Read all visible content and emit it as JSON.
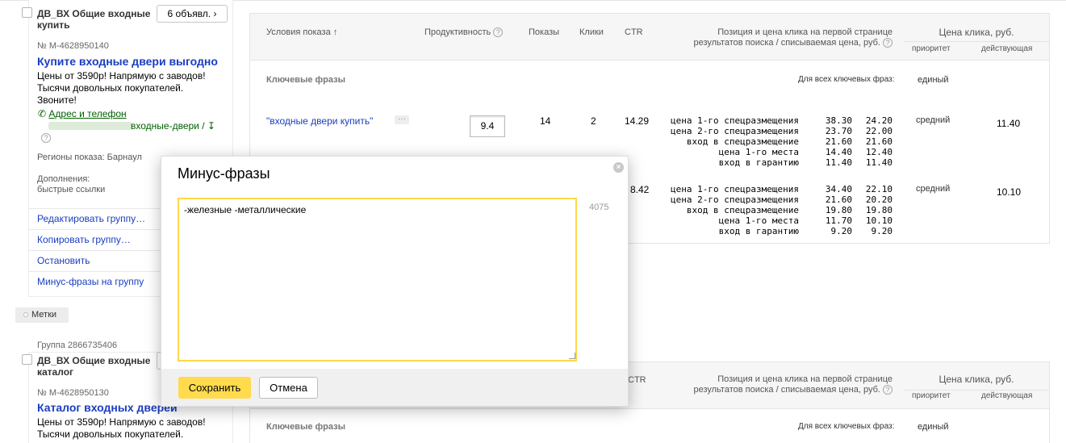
{
  "group1": {
    "title_line1": "ДВ_ВХ Общие входные",
    "title_line2": "купить",
    "ads_button": "6 объявл.",
    "ad_number": "№ M-4628950140",
    "ad_title": "Купите входные двери выгодно",
    "ad_text_lines": [
      "Цены от 3590р! Напрямую с заводов!",
      "Тысячи довольных покупателей.",
      "Звоните!"
    ],
    "address_link": "Адрес и телефон",
    "url_fragment": "входные-двери /",
    "regions": "Регионы показа: Барнаул",
    "extras_label": "Дополнения:",
    "extras_value": "быстрые ссылки",
    "menu": [
      "Редактировать группу…",
      "Копировать группу…",
      "Остановить",
      "Минус-фразы на группу"
    ]
  },
  "tags_button": "Метки",
  "group2": {
    "group_id": "Группа 2866735406",
    "title_line1": "ДВ_ВХ Общие входные",
    "title_line2": "каталог",
    "ad_number": "№ M-4628950130",
    "ad_title": "Каталог входных дверей",
    "ad_text_lines": [
      "Цены от 3590р! Напрямую с заводов!",
      "Тысячи довольных покупателей."
    ]
  },
  "table": {
    "col_conditions": "Условия показа",
    "sort_arrow": "↑",
    "col_productivity": "Продуктивность",
    "col_impressions": "Показы",
    "col_clicks": "Клики",
    "col_ctr": "CTR",
    "col_position_line1": "Позиция и цена клика на первой странице",
    "col_position_line2": "результатов поиска / списываемая цена, руб.",
    "col_price": "Цена клика, руб.",
    "col_priority": "приоритет",
    "col_effective": "действующая",
    "section_label": "Ключевые фразы",
    "all_phrases_label": "Для всех ключевых фраз:",
    "all_phrases_value": "единый",
    "rows": [
      {
        "phrase": "\"входные двери купить\"",
        "dots": "···",
        "productivity": "9.4",
        "impressions": "14",
        "clicks": "2",
        "ctr": "14.29",
        "positions": [
          {
            "label": "цена 1-го спецразмещения",
            "v1": "38.30",
            "v2": "24.20"
          },
          {
            "label": "цена 2-го спецразмещения",
            "v1": "23.70",
            "v2": "22.00"
          },
          {
            "label": "вход в спецразмещение",
            "v1": "21.60",
            "v2": "21.60"
          },
          {
            "label": "цена 1-го места",
            "v1": "14.40",
            "v2": "12.40"
          },
          {
            "label": "вход в гарантию",
            "v1": "11.40",
            "v2": "11.40"
          }
        ],
        "priority": "средний",
        "effective": "11.40"
      },
      {
        "ctr": "8.42",
        "positions": [
          {
            "label": "цена 1-го спецразмещения",
            "v1": "34.40",
            "v2": "22.10"
          },
          {
            "label": "цена 2-го спецразмещения",
            "v1": "21.60",
            "v2": "20.20"
          },
          {
            "label": "вход в спецразмещение",
            "v1": "19.80",
            "v2": "19.80"
          },
          {
            "label": "цена 1-го места",
            "v1": "11.70",
            "v2": "10.10"
          },
          {
            "label": "вход в гарантию",
            "v1": "9.20",
            "v2": "9.20"
          }
        ],
        "priority": "средний",
        "effective": "10.10"
      }
    ]
  },
  "table2": {
    "col_ctr": "CTR",
    "col_position_line1": "Позиция и цена клика на первой странице",
    "col_position_line2": "результатов поиска / списываемая цена, руб.",
    "col_price": "Цена клика, руб.",
    "col_priority": "приоритет",
    "col_effective": "действующая",
    "section_label": "Ключевые фразы",
    "all_phrases_label": "Для всех ключевых фраз:",
    "all_phrases_value": "единый"
  },
  "modal": {
    "title": "Минус-фразы",
    "textarea_value": "-железные -металлические",
    "char_counter": "4075",
    "save_label": "Сохранить",
    "cancel_label": "Отмена"
  }
}
